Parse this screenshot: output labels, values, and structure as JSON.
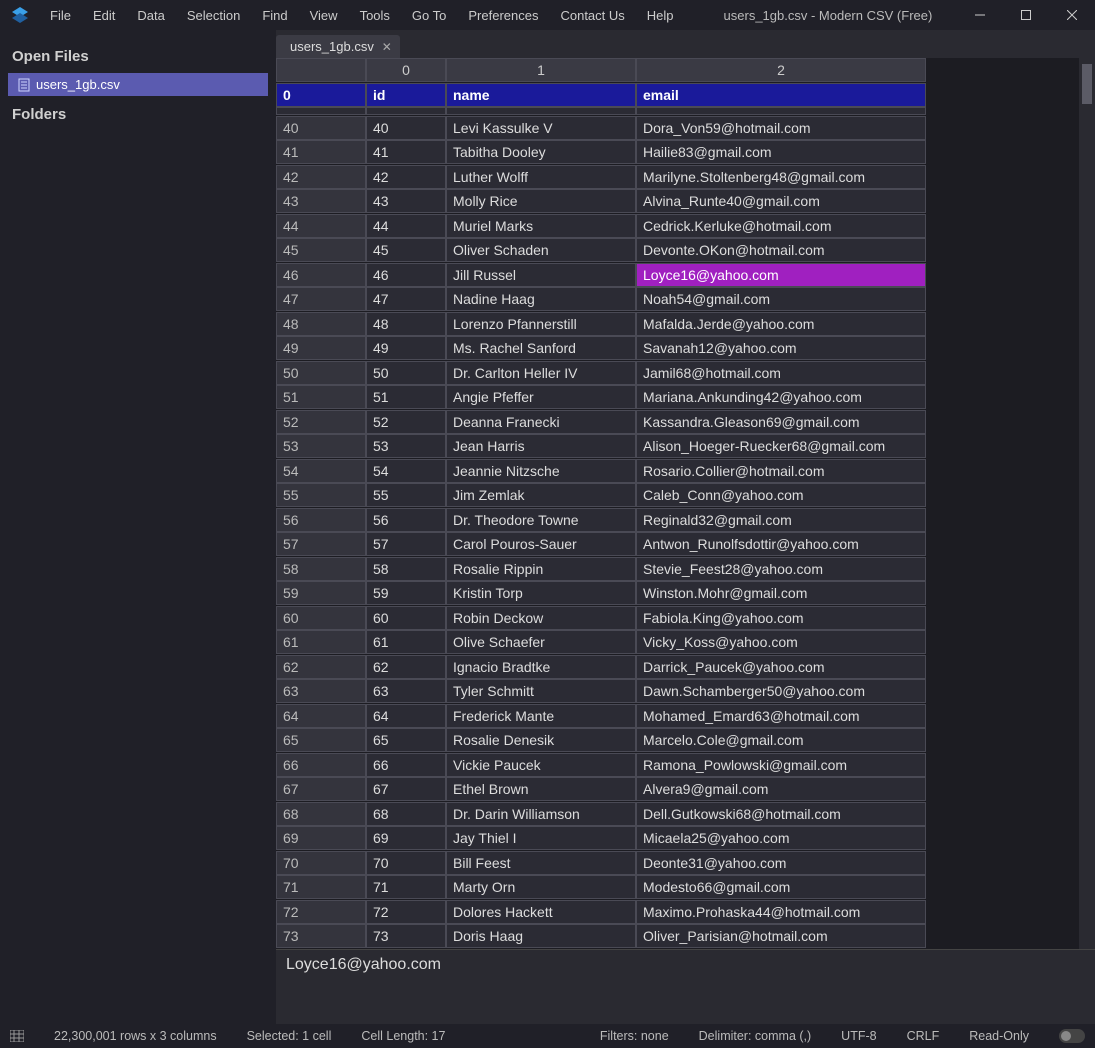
{
  "titlebar": {
    "title": "users_1gb.csv - Modern CSV (Free)",
    "menu": [
      "File",
      "Edit",
      "Data",
      "Selection",
      "Find",
      "View",
      "Tools",
      "Go To",
      "Preferences",
      "Contact Us",
      "Help"
    ]
  },
  "sidebar": {
    "open_files_label": "Open Files",
    "folders_label": "Folders",
    "open_file": "users_1gb.csv"
  },
  "tab": {
    "label": "users_1gb.csv"
  },
  "col_headers": [
    "",
    "0",
    "1",
    "2"
  ],
  "header_row": {
    "rownum": "0",
    "cells": [
      "id",
      "name",
      "email"
    ]
  },
  "rows": [
    {
      "n": "40",
      "id": "40",
      "name": "Levi Kassulke V",
      "email": "Dora_Von59@hotmail.com"
    },
    {
      "n": "41",
      "id": "41",
      "name": "Tabitha Dooley",
      "email": "Hailie83@gmail.com"
    },
    {
      "n": "42",
      "id": "42",
      "name": "Luther Wolff",
      "email": "Marilyne.Stoltenberg48@gmail.com"
    },
    {
      "n": "43",
      "id": "43",
      "name": "Molly Rice",
      "email": "Alvina_Runte40@gmail.com"
    },
    {
      "n": "44",
      "id": "44",
      "name": "Muriel Marks",
      "email": "Cedrick.Kerluke@hotmail.com"
    },
    {
      "n": "45",
      "id": "45",
      "name": "Oliver Schaden",
      "email": "Devonte.OKon@hotmail.com"
    },
    {
      "n": "46",
      "id": "46",
      "name": "Jill Russel",
      "email": "Loyce16@yahoo.com",
      "selected_col": 2
    },
    {
      "n": "47",
      "id": "47",
      "name": "Nadine Haag",
      "email": "Noah54@gmail.com"
    },
    {
      "n": "48",
      "id": "48",
      "name": "Lorenzo Pfannerstill",
      "email": "Mafalda.Jerde@yahoo.com"
    },
    {
      "n": "49",
      "id": "49",
      "name": "Ms. Rachel Sanford",
      "email": "Savanah12@yahoo.com"
    },
    {
      "n": "50",
      "id": "50",
      "name": "Dr. Carlton Heller IV",
      "email": "Jamil68@hotmail.com"
    },
    {
      "n": "51",
      "id": "51",
      "name": "Angie Pfeffer",
      "email": "Mariana.Ankunding42@yahoo.com"
    },
    {
      "n": "52",
      "id": "52",
      "name": "Deanna Franecki",
      "email": "Kassandra.Gleason69@gmail.com"
    },
    {
      "n": "53",
      "id": "53",
      "name": "Jean Harris",
      "email": "Alison_Hoeger-Ruecker68@gmail.com"
    },
    {
      "n": "54",
      "id": "54",
      "name": "Jeannie Nitzsche",
      "email": "Rosario.Collier@hotmail.com"
    },
    {
      "n": "55",
      "id": "55",
      "name": "Jim Zemlak",
      "email": "Caleb_Conn@yahoo.com"
    },
    {
      "n": "56",
      "id": "56",
      "name": "Dr. Theodore Towne",
      "email": "Reginald32@gmail.com"
    },
    {
      "n": "57",
      "id": "57",
      "name": "Carol Pouros-Sauer",
      "email": "Antwon_Runolfsdottir@yahoo.com"
    },
    {
      "n": "58",
      "id": "58",
      "name": "Rosalie Rippin",
      "email": "Stevie_Feest28@yahoo.com"
    },
    {
      "n": "59",
      "id": "59",
      "name": "Kristin Torp",
      "email": "Winston.Mohr@gmail.com"
    },
    {
      "n": "60",
      "id": "60",
      "name": "Robin Deckow",
      "email": "Fabiola.King@yahoo.com"
    },
    {
      "n": "61",
      "id": "61",
      "name": "Olive Schaefer",
      "email": "Vicky_Koss@yahoo.com"
    },
    {
      "n": "62",
      "id": "62",
      "name": "Ignacio Bradtke",
      "email": "Darrick_Paucek@yahoo.com"
    },
    {
      "n": "63",
      "id": "63",
      "name": "Tyler Schmitt",
      "email": "Dawn.Schamberger50@yahoo.com"
    },
    {
      "n": "64",
      "id": "64",
      "name": "Frederick Mante",
      "email": "Mohamed_Emard63@hotmail.com"
    },
    {
      "n": "65",
      "id": "65",
      "name": "Rosalie Denesik",
      "email": "Marcelo.Cole@gmail.com"
    },
    {
      "n": "66",
      "id": "66",
      "name": "Vickie Paucek",
      "email": "Ramona_Powlowski@gmail.com"
    },
    {
      "n": "67",
      "id": "67",
      "name": "Ethel Brown",
      "email": "Alvera9@gmail.com"
    },
    {
      "n": "68",
      "id": "68",
      "name": "Dr. Darin Williamson",
      "email": "Dell.Gutkowski68@hotmail.com"
    },
    {
      "n": "69",
      "id": "69",
      "name": "Jay Thiel I",
      "email": "Micaela25@yahoo.com"
    },
    {
      "n": "70",
      "id": "70",
      "name": "Bill Feest",
      "email": "Deonte31@yahoo.com"
    },
    {
      "n": "71",
      "id": "71",
      "name": "Marty Orn",
      "email": "Modesto66@gmail.com"
    },
    {
      "n": "72",
      "id": "72",
      "name": "Dolores Hackett",
      "email": "Maximo.Prohaska44@hotmail.com"
    },
    {
      "n": "73",
      "id": "73",
      "name": "Doris Haag",
      "email": "Oliver_Parisian@hotmail.com"
    }
  ],
  "cell_preview": "Loyce16@yahoo.com",
  "status": {
    "dims": "22,300,001 rows x 3 columns",
    "sel": "Selected: 1 cell",
    "len": "Cell Length: 17",
    "filters": "Filters: none",
    "delim": "Delimiter: comma (,)",
    "enc": "UTF-8",
    "eol": "CRLF",
    "ro": "Read-Only"
  }
}
